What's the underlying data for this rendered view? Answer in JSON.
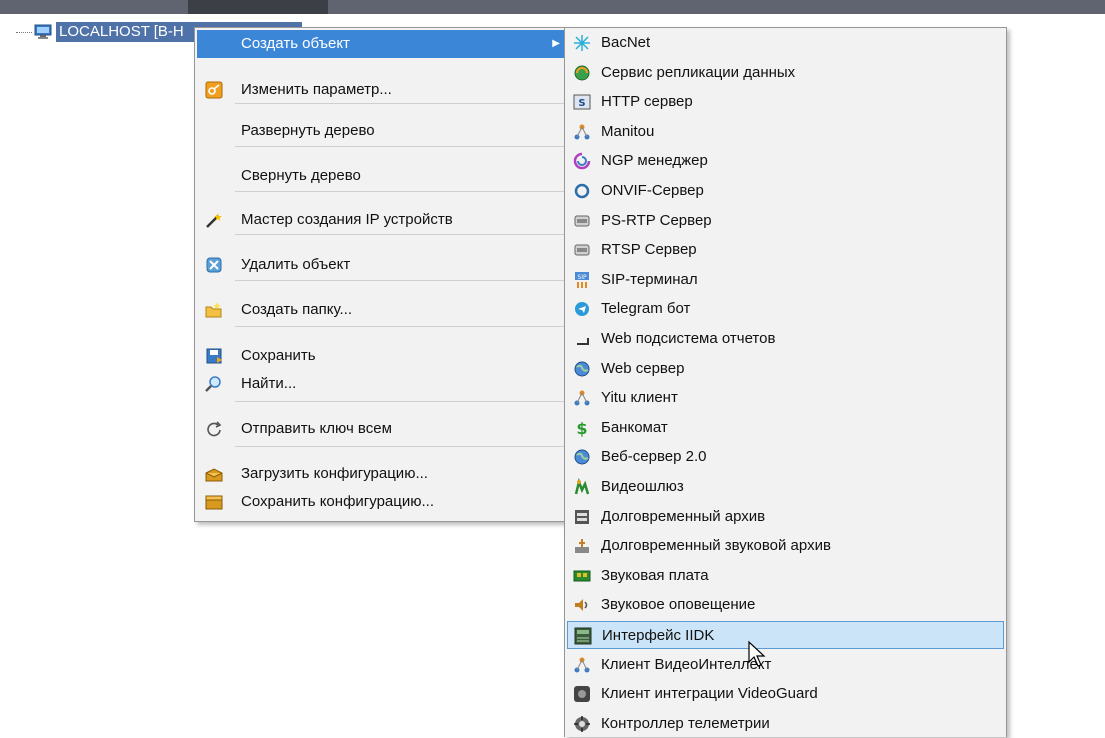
{
  "tree": {
    "label": "LOCALHOST [B-H"
  },
  "main_menu": {
    "items": [
      {
        "label": "Создать объект",
        "icon": "none",
        "highlighted": true,
        "submenu": true
      },
      {
        "label": "Изменить параметр...",
        "icon": "key-icon"
      },
      {
        "label": "Развернуть дерево",
        "icon": "none"
      },
      {
        "label": "Свернуть дерево",
        "icon": "none"
      },
      {
        "label": "Мастер создания IP устройств",
        "icon": "wand-icon"
      },
      {
        "label": "Удалить объект",
        "icon": "delete-icon"
      },
      {
        "label": "Создать папку...",
        "icon": "folder-new-icon"
      },
      {
        "label": "Сохранить",
        "icon": "save-icon"
      },
      {
        "label": "Найти...",
        "icon": "search-icon"
      },
      {
        "label": "Отправить ключ всем",
        "icon": "refresh-icon"
      },
      {
        "label": "Загрузить конфигурацию...",
        "icon": "box-open-icon"
      },
      {
        "label": "Сохранить конфигурацию...",
        "icon": "box-closed-icon"
      }
    ],
    "arrow": "▶"
  },
  "sub_menu": {
    "items": [
      {
        "label": "BacNet",
        "icon": "bacnet-icon"
      },
      {
        "label": "Сервис репликации данных",
        "icon": "replication-icon"
      },
      {
        "label": "HTTP сервер",
        "icon": "http-icon"
      },
      {
        "label": "Manitou",
        "icon": "network-icon"
      },
      {
        "label": "NGP менеджер",
        "icon": "ngp-icon"
      },
      {
        "label": "ONVIF-Сервер",
        "icon": "circle-icon"
      },
      {
        "label": "PS-RTP Сервер",
        "icon": "server-icon"
      },
      {
        "label": "RTSP Сервер",
        "icon": "server-icon"
      },
      {
        "label": "SIP-терминал",
        "icon": "sip-icon"
      },
      {
        "label": "Telegram бот",
        "icon": "telegram-icon"
      },
      {
        "label": "Web подсистема отчетов",
        "icon": "report-icon"
      },
      {
        "label": "Web сервер",
        "icon": "globe-icon"
      },
      {
        "label": "Yitu клиент",
        "icon": "network-icon"
      },
      {
        "label": "Банкомат",
        "icon": "dollar-icon"
      },
      {
        "label": "Веб-сервер 2.0",
        "icon": "globe-icon"
      },
      {
        "label": "Видеошлюз",
        "icon": "gateway-icon"
      },
      {
        "label": "Долговременный архив",
        "icon": "archive-icon"
      },
      {
        "label": "Долговременный звуковой архив",
        "icon": "audio-archive-icon"
      },
      {
        "label": "Звуковая плата",
        "icon": "soundcard-icon"
      },
      {
        "label": "Звуковое оповещение",
        "icon": "speaker-icon"
      },
      {
        "label": "Интерфейс IIDK",
        "icon": "iidk-icon",
        "highlighted": true
      },
      {
        "label": "Клиент ВидеоИнтеллект",
        "icon": "network-icon"
      },
      {
        "label": "Клиент интеграции VideoGuard",
        "icon": "videoguard-icon"
      },
      {
        "label": "Контроллер телеметрии",
        "icon": "telemetry-icon"
      }
    ]
  },
  "colors": {
    "highlight": "#3c86d8",
    "hover": "#cce4f7",
    "menu_bg": "#f2f2f2",
    "tree_selection": "#4f72a8"
  }
}
